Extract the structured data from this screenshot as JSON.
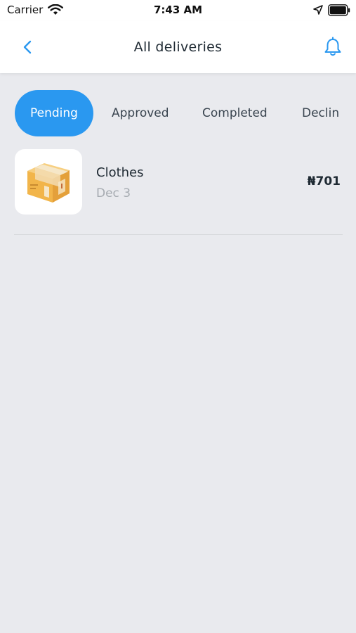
{
  "status_bar": {
    "carrier": "Carrier",
    "time": "7:43 AM"
  },
  "header": {
    "title": "All deliveries",
    "back_icon": "chevron-left-icon",
    "bell_icon": "bell-icon"
  },
  "tabs": [
    {
      "label": "Pending",
      "active": true
    },
    {
      "label": "Approved",
      "active": false
    },
    {
      "label": "Completed",
      "active": false
    },
    {
      "label": "Declin",
      "active": false
    }
  ],
  "deliveries": [
    {
      "title": "Clothes",
      "date": "Dec 3",
      "price": "₦701",
      "icon": "package-box-icon"
    }
  ],
  "colors": {
    "accent": "#2a98f0",
    "background": "#e9eaee",
    "box": "#f2b54a"
  }
}
